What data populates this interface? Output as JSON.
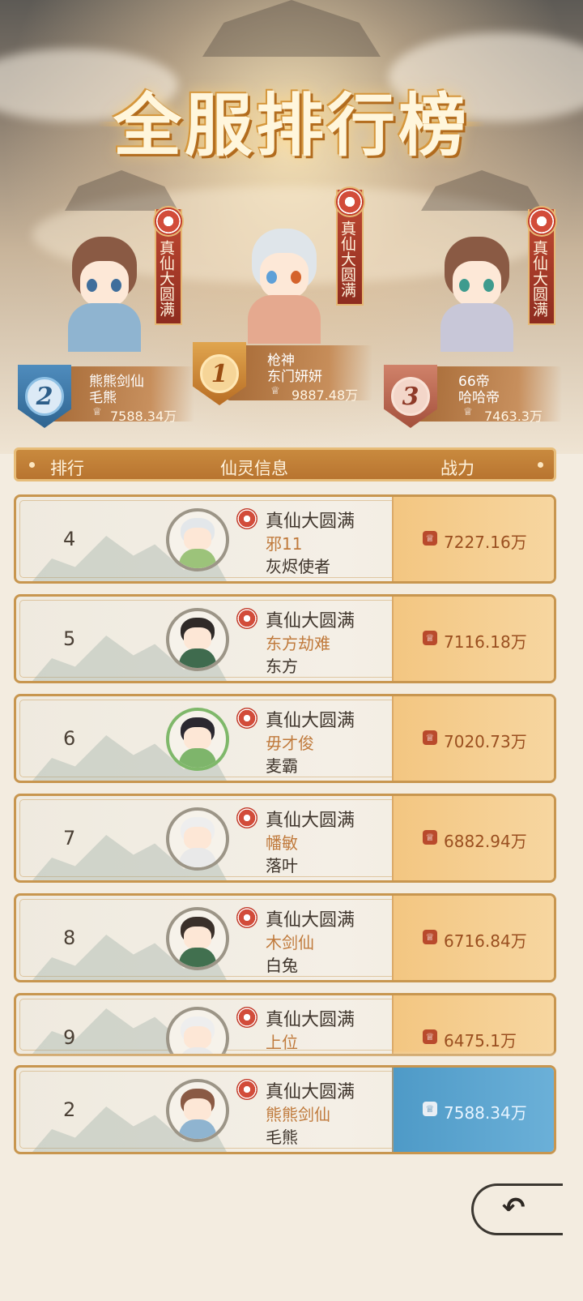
{
  "title": "全服排行榜",
  "podium": [
    {
      "rank_badge": "2",
      "banner": "真仙大圆满",
      "line1": "熊熊剑仙",
      "line2": "毛熊",
      "power": "7588.34万"
    },
    {
      "rank_badge": "1",
      "banner": "真仙大圆满",
      "line1": "枪神",
      "line2": "东门妍妍",
      "power": "9887.48万"
    },
    {
      "rank_badge": "3",
      "banner": "真仙大圆满",
      "line1": "66帝",
      "line2": "哈哈帝",
      "power": "7463.3万"
    }
  ],
  "columns": {
    "rank": "排行",
    "info": "仙灵信息",
    "power": "战力"
  },
  "rows": [
    {
      "rank": "4",
      "realm": "真仙大圆满",
      "nick": "邪11",
      "guild": "灰烬使者",
      "power": "7227.16万"
    },
    {
      "rank": "5",
      "realm": "真仙大圆满",
      "nick": "东方劫难",
      "guild": "东方",
      "power": "7116.18万"
    },
    {
      "rank": "6",
      "realm": "真仙大圆满",
      "nick": "毋才俊",
      "guild": "麦霸",
      "power": "7020.73万"
    },
    {
      "rank": "7",
      "realm": "真仙大圆满",
      "nick": "幡敏",
      "guild": "落叶",
      "power": "6882.94万"
    },
    {
      "rank": "8",
      "realm": "真仙大圆满",
      "nick": "木剑仙",
      "guild": "白兔",
      "power": "6716.84万"
    },
    {
      "rank": "9",
      "realm": "真仙大圆满",
      "nick": "上位",
      "guild": "",
      "power": "6475.1万"
    }
  ],
  "self_row": {
    "rank": "2",
    "realm": "真仙大圆满",
    "nick": "熊熊剑仙",
    "guild": "毛熊",
    "power": "7588.34万"
  },
  "icons": {
    "power": "cup-icon",
    "realm": "rose-icon",
    "back": "back-arrow-icon"
  },
  "colors": {
    "accent": "#b87430",
    "self_highlight": "#4e9ac7",
    "nick": "#c07a3c"
  }
}
